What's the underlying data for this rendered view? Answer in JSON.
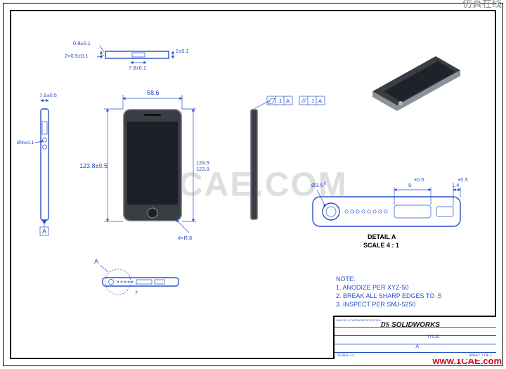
{
  "app": "SolidWorks",
  "drawing": {
    "subject": "Mobile phone (iPhone-style) engineering drawing",
    "detail_label": "DETAIL A",
    "detail_scale": "SCALE 4 : 1",
    "datum_letters": [
      "A"
    ],
    "gdt_frames": [
      {
        "type": "flatness",
        "tol": ".1",
        "datum": "A"
      },
      {
        "type": "parallelism",
        "tol": ".1",
        "datum": "A"
      }
    ]
  },
  "dimensions": {
    "top_thickness_upper": "0.8±0.1",
    "top_thickness_lower": "2×0.5±0.1",
    "top_height_small": "2±0.1",
    "top_width_small": "7.9±0.1",
    "front_width": "58.6",
    "front_height": "123.8±0.5",
    "front_inner_1": "124.9",
    "front_inner_2": "123.9",
    "front_button_note": "4×R.8",
    "side_left_height": "7.6±0.5",
    "side_left_dia": "Ø4±0.1",
    "bottom_hint": "7",
    "detail_jack": "Ø3.5",
    "detail_pitch": "9",
    "detail_pitch_tol": "±0.5",
    "detail_edge": "1.4",
    "detail_edge_tol": "±0.5",
    "detail_small": "0"
  },
  "notes": {
    "heading": "NOTE:",
    "items": [
      "1.   ANODIZE PER XYZ-50",
      "2.   BREAK ALL SHARP EDGES TO .5",
      "3.   INSPECT PER SMJ-5250"
    ]
  },
  "titleblock": {
    "logo": "SOLIDWORKS",
    "logo_prefix": "DS",
    "unless": "UNLESS OTHERWISE SPECIFIED",
    "scale": "SCALE 1:1",
    "sheet": "SHEET 1 OF 1",
    "size": "A",
    "title": "TITLE:"
  },
  "watermarks": {
    "center": "1CAE.COM",
    "top_right": "仿真在线",
    "bottom_right": "www.1CAE.com"
  }
}
